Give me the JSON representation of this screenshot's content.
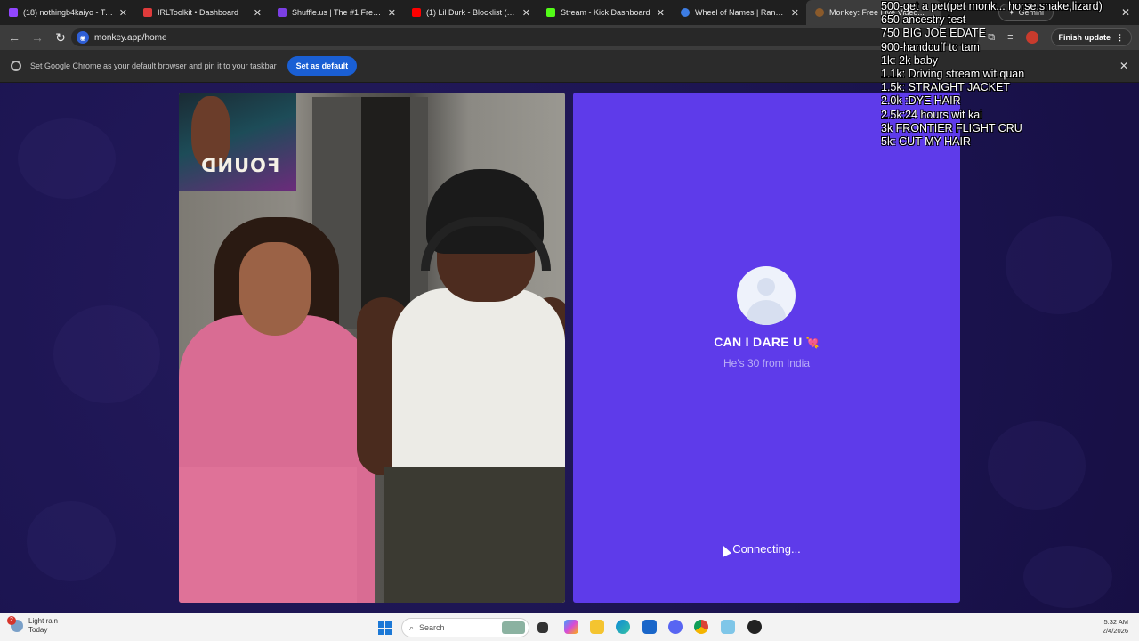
{
  "browser": {
    "tabs": [
      {
        "title": "(18) nothingb4kaiyo - Twitch",
        "color": "#9146ff"
      },
      {
        "title": "IRLToolkit • Dashboard",
        "color": "#e03b3b"
      },
      {
        "title": "Shuffle.us | The #1 Free to Pl...",
        "color": "#7b3fe4"
      },
      {
        "title": "(1) Lil Durk - Blocklist (Officia...",
        "color": "#ff0000"
      },
      {
        "title": "Stream - Kick Dashboard",
        "color": "#53fc18"
      },
      {
        "title": "Wheel of Names | Random n...",
        "color": "#3d7de4"
      },
      {
        "title": "Monkey: Free Live Video...",
        "color": "#8a5a2b"
      }
    ],
    "gemini_label": "Gemini",
    "url": "monkey.app/home",
    "finish_update": "Finish update",
    "infobar_message": "Set Google Chrome as your default browser and pin it to your taskbar",
    "set_default_label": "Set as default"
  },
  "match": {
    "name": "CAN I DARE U",
    "emoji": "💘",
    "subtitle": "He's 30 from India",
    "status": "Connecting...",
    "card_color": "#5e3bea"
  },
  "video": {
    "poster_text": "FOUND"
  },
  "goals": [
    "500-get a pet(pet monk... horse,snake,lizard)",
    "650 ancestry test",
    "750 BIG JOE EDATE",
    "900-handcuff to tam",
    "1k: 2k baby",
    "1.1k: Driving stream wit quan",
    "1.5k: STRAIGHT JACKET",
    "2.0k :DYE HAIR",
    "2.5k:24 hours wit kai",
    "3k FRONTIER FLIGHT CRU",
    "5k: CUT MY HAIR"
  ],
  "taskbar": {
    "weather_text": "Light rain",
    "weather_sub": "Today",
    "weather_badge": "2",
    "search_placeholder": "Search",
    "time": "5:32 AM",
    "date": "2/4/2026"
  }
}
